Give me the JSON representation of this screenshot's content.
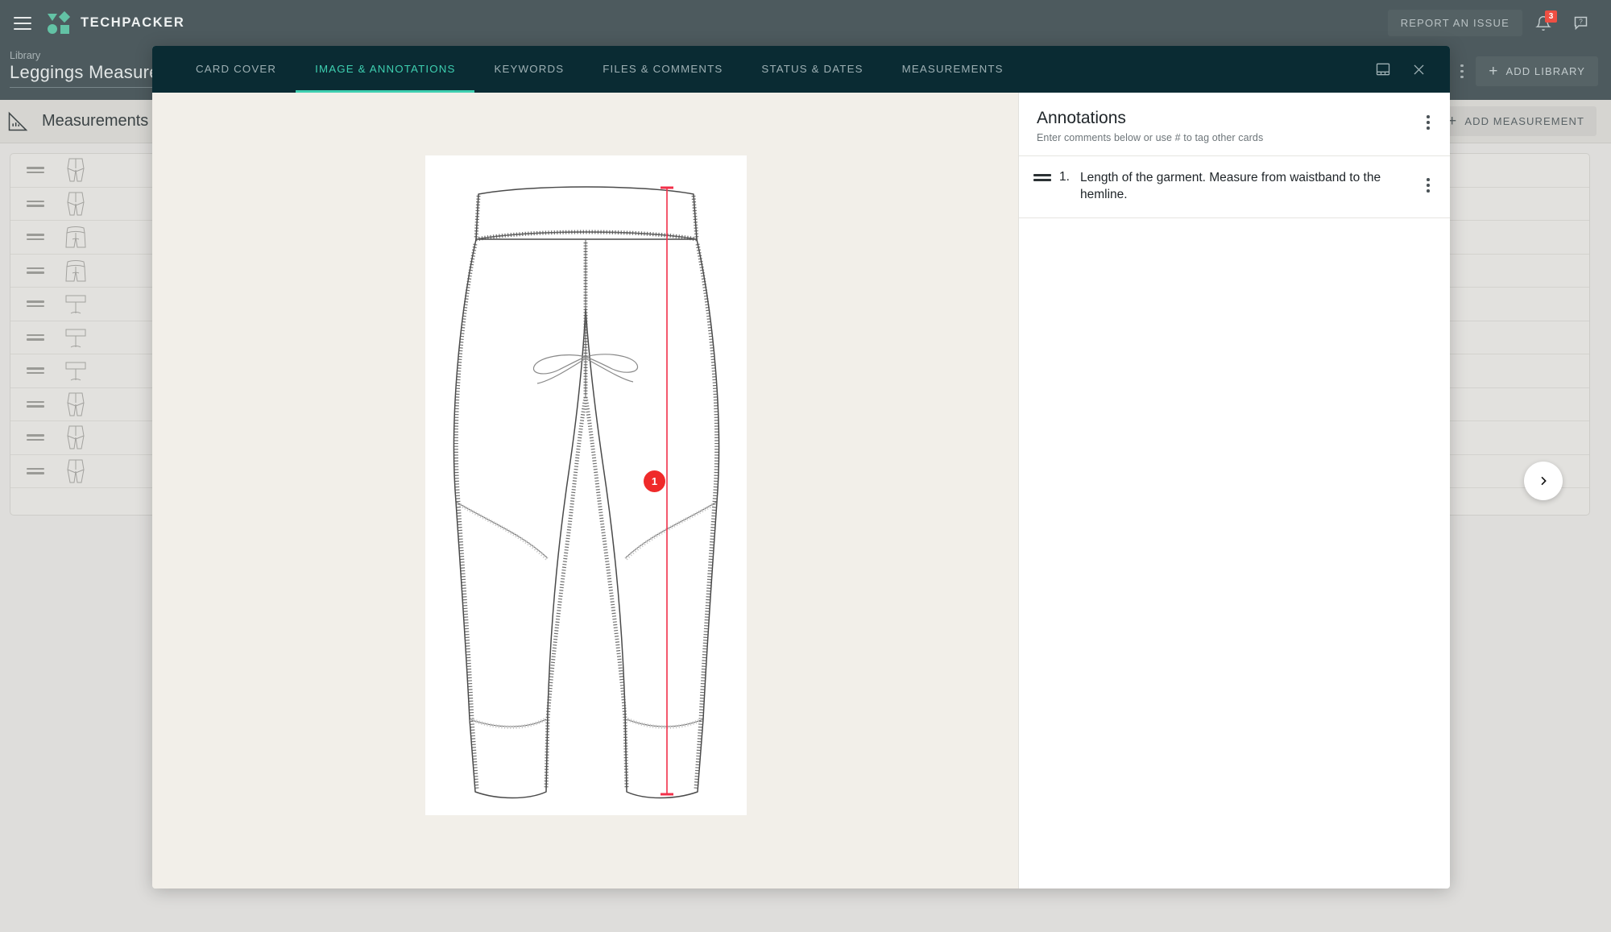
{
  "app": {
    "brand_name": "TECHPACKER",
    "report_issue_label": "REPORT AN ISSUE",
    "notification_count": "3"
  },
  "page": {
    "breadcrumb": "Library",
    "title": "Leggings Measurements",
    "add_library_label": "ADD LIBRARY"
  },
  "section": {
    "title": "Measurements",
    "add_measurement_label": "ADD MEASUREMENT"
  },
  "list": {
    "rows": [
      {
        "thumb": "legs"
      },
      {
        "thumb": "legs"
      },
      {
        "thumb": "hips"
      },
      {
        "thumb": "hips"
      },
      {
        "thumb": "band"
      },
      {
        "thumb": "band"
      },
      {
        "thumb": "band"
      },
      {
        "thumb": "legs"
      },
      {
        "thumb": "legs"
      },
      {
        "thumb": "legs"
      }
    ]
  },
  "modal": {
    "tabs": [
      {
        "label": "CARD COVER",
        "active": false
      },
      {
        "label": "IMAGE & ANNOTATIONS",
        "active": true
      },
      {
        "label": "KEYWORDS",
        "active": false
      },
      {
        "label": "FILES & COMMENTS",
        "active": false
      },
      {
        "label": "STATUS & DATES",
        "active": false
      },
      {
        "label": "MEASUREMENTS",
        "active": false
      }
    ],
    "layout_icon": "panel-layout-icon",
    "close_icon": "close-icon",
    "marker_label": "1"
  },
  "annotations": {
    "title": "Annotations",
    "subtitle": "Enter comments below or use # to tag other cards",
    "items": [
      {
        "number": "1.",
        "text": "Length of the garment. Measure from waistband to the hemline."
      }
    ]
  },
  "nav": {
    "next_label": "›"
  },
  "colors": {
    "appbar": "#4d5a5e",
    "modal_header": "#0a2b33",
    "accent_teal": "#3ecfb0",
    "marker_red": "#ef2a2a",
    "badge_red": "#ef4f43",
    "modal_body": "#f2efe9",
    "page_bg": "#dedddb"
  }
}
